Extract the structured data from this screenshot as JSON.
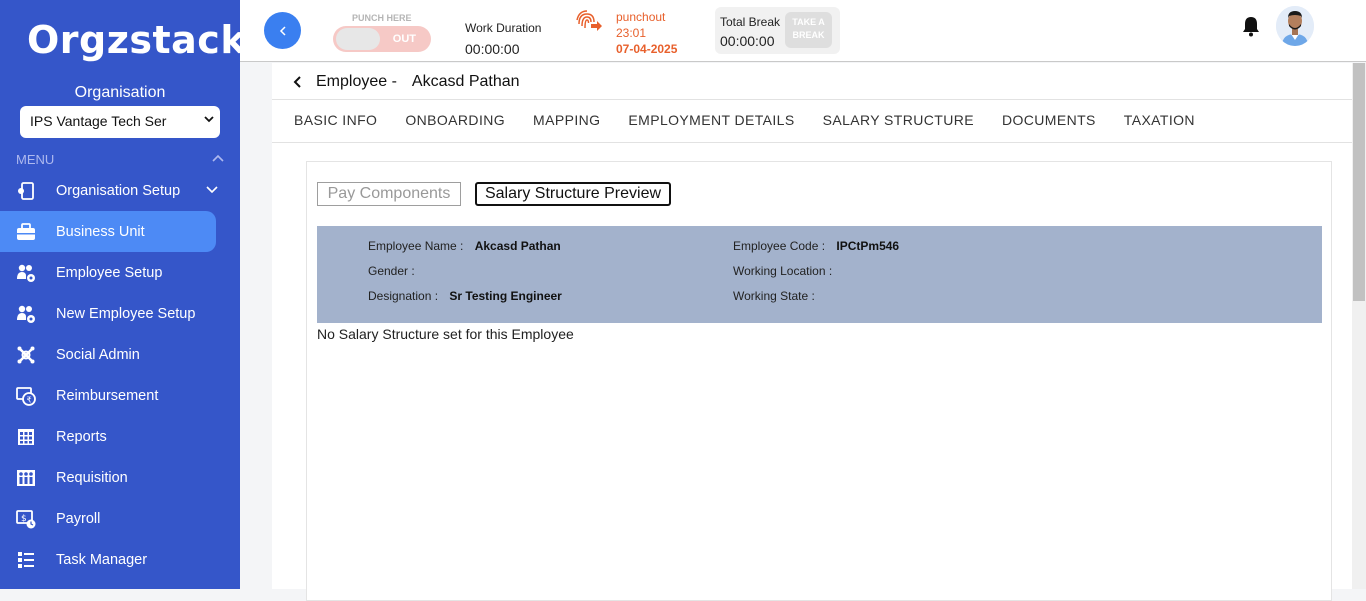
{
  "app": {
    "logo": "Orgzstack"
  },
  "sidebar": {
    "org_label": "Organisation",
    "org_selected": "IPS Vantage Tech Ser",
    "menu_label": "MENU",
    "items": [
      {
        "label": "Organisation Setup",
        "icon": "org-setup-icon"
      },
      {
        "label": "Business Unit",
        "icon": "briefcase-icon"
      },
      {
        "label": "Employee Setup",
        "icon": "users-gear-icon"
      },
      {
        "label": "New Employee Setup",
        "icon": "users-gear-icon"
      },
      {
        "label": "Social Admin",
        "icon": "social-icon"
      },
      {
        "label": "Reimbursement",
        "icon": "reimbursement-icon"
      },
      {
        "label": "Reports",
        "icon": "grid-icon"
      },
      {
        "label": "Requisition",
        "icon": "requisition-icon"
      },
      {
        "label": "Payroll",
        "icon": "payroll-icon"
      },
      {
        "label": "Task Manager",
        "icon": "list-icon"
      }
    ],
    "active_index": 1
  },
  "topbar": {
    "punch_label": "PUNCH HERE",
    "toggle_text": "OUT",
    "work_duration_label": "Work Duration",
    "work_duration_value": "00:00:00",
    "punch_status": "punchout",
    "punch_time": "23:01",
    "punch_date": "07-04-2025",
    "total_break_label": "Total Break",
    "total_break_value": "00:00:00",
    "take_break_line1": "TAKE A",
    "take_break_line2": "BREAK"
  },
  "page": {
    "crumb_prefix": "Employee -",
    "employee_name": "Akcasd Pathan",
    "tabs": [
      "BASIC INFO",
      "ONBOARDING",
      "MAPPING",
      "EMPLOYMENT DETAILS",
      "SALARY STRUCTURE",
      "DOCUMENTS",
      "TAXATION"
    ],
    "btn_pay_components": "Pay Components",
    "btn_salary_preview": "Salary Structure Preview",
    "info": {
      "employee_name_label": "Employee Name :",
      "employee_name_value": "Akcasd Pathan",
      "gender_label": "Gender :",
      "gender_value": "",
      "designation_label": "Designation :",
      "designation_value": "Sr Testing Engineer",
      "employee_code_label": "Employee Code :",
      "employee_code_value": "IPCtPm546",
      "working_location_label": "Working Location :",
      "working_location_value": "",
      "working_state_label": "Working State :",
      "working_state_value": ""
    },
    "no_data_message": "No Salary Structure set for this Employee"
  },
  "colors": {
    "sidebar_bg": "#3556c9",
    "active_item": "#4d8af5",
    "accent_blue": "#3a7ff0",
    "punch_orange": "#e8602c",
    "info_bg": "#a3b2cc"
  }
}
